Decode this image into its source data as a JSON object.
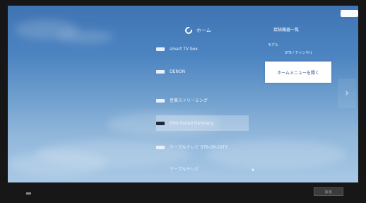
{
  "menu": {
    "title": "ホーム",
    "items": [
      {
        "label": "smart TV box",
        "selected": false
      },
      {
        "label": "DENON",
        "selected": false
      },
      {
        "label": "音楽ストリーミング",
        "selected": false
      },
      {
        "label": "ENG Install Germany",
        "selected": false
      },
      {
        "label": "ケーブルテレビ STB-SR-10TY",
        "selected": false
      },
      {
        "label": "ケーブルテレビ",
        "selected": true
      }
    ]
  },
  "panel": {
    "title": "接続機器一覧",
    "sub_label": "モデル",
    "value_label": "STB / チャンネル",
    "action_label": "ホームメニューを開く"
  },
  "footer": {
    "button_label": "戻る"
  },
  "colors": {
    "sky_top": "#3f74b3",
    "sky_bottom": "#a8c8e5",
    "selected_bg": "rgba(255,255,255,0.28)"
  }
}
